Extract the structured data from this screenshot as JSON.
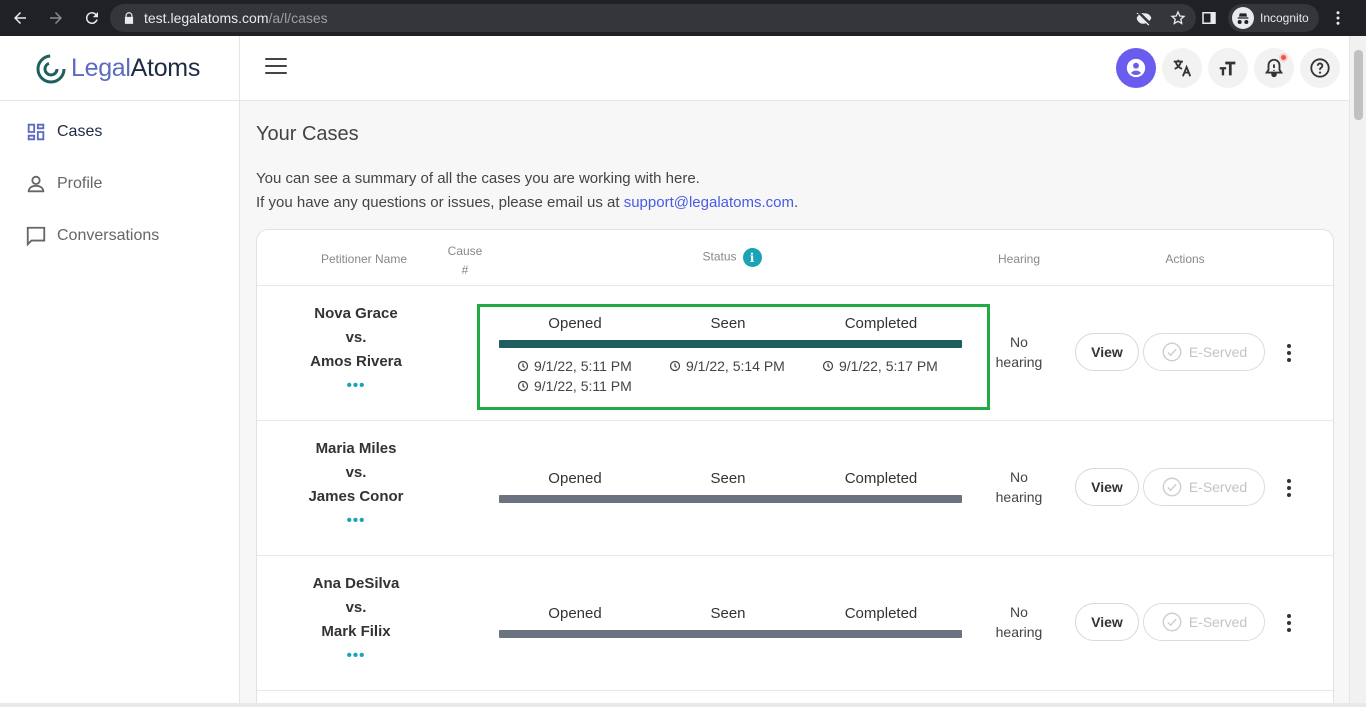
{
  "browser": {
    "url_host": "test.legalatoms.com",
    "url_path": "/a/l/cases",
    "profile_label": "Incognito"
  },
  "app": {
    "logo_part1": "Legal",
    "logo_part2": "Atoms"
  },
  "sidebar": {
    "items": [
      {
        "label": "Cases",
        "icon": "dashboard-icon",
        "active": true
      },
      {
        "label": "Profile",
        "icon": "person-icon",
        "active": false
      },
      {
        "label": "Conversations",
        "icon": "chat-icon",
        "active": false
      }
    ]
  },
  "page": {
    "title": "Your Cases",
    "desc_line1": "You can see a summary of all the cases you are working with here.",
    "desc_line2_prefix": "If you have any questions or issues, please email us at ",
    "support_email": "support@legalatoms.com",
    "desc_line2_suffix": "."
  },
  "table": {
    "headers": {
      "petitioner": "Petitioner Name",
      "cause_line1": "Cause",
      "cause_line2": "#",
      "status": "Status",
      "hearing": "Hearing",
      "actions": "Actions"
    },
    "stages": [
      "Opened",
      "Seen",
      "Completed"
    ],
    "rows": [
      {
        "petitioner": "Nova Grace",
        "vs": "vs.",
        "respondent": "Amos Rivera",
        "more": "•••",
        "bar_color": "#1e5e5e",
        "times": {
          "opened": [
            "9/1/22, 5:11 PM",
            "9/1/22, 5:11 PM"
          ],
          "seen": "9/1/22, 5:14 PM",
          "completed": "9/1/22, 5:17 PM"
        },
        "hearing_line1": "No",
        "hearing_line2": "hearing",
        "view_label": "View",
        "eserved_label": "E-Served"
      },
      {
        "petitioner": "Maria Miles",
        "vs": "vs.",
        "respondent": "James Conor",
        "more": "•••",
        "bar_color": "#6b7280",
        "hearing_line1": "No",
        "hearing_line2": "hearing",
        "view_label": "View",
        "eserved_label": "E-Served"
      },
      {
        "petitioner": "Ana DeSilva",
        "vs": "vs.",
        "respondent": "Mark Filix",
        "more": "•••",
        "bar_color": "#6b7280",
        "hearing_line1": "No",
        "hearing_line2": "hearing",
        "view_label": "View",
        "eserved_label": "E-Served"
      }
    ]
  }
}
